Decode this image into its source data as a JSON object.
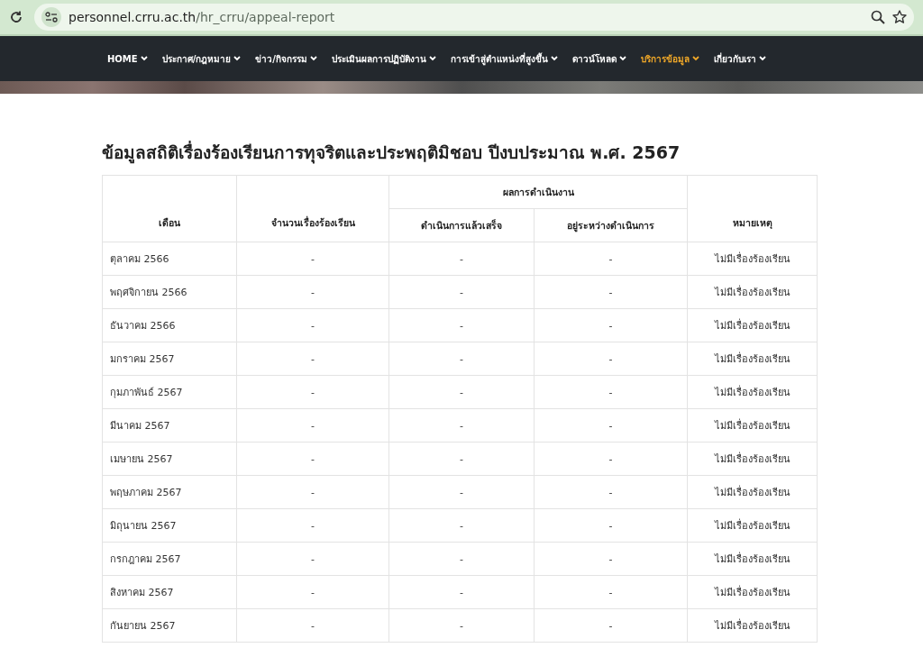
{
  "browser": {
    "url_host": "personnel.crru.ac.th",
    "url_path": "/hr_crru/appeal-report"
  },
  "nav": [
    {
      "label": "HOME",
      "selected": false
    },
    {
      "label": "ประกาศ/กฎหมาย",
      "selected": false
    },
    {
      "label": "ข่าว/กิจกรรม",
      "selected": false
    },
    {
      "label": "ประเมินผลการปฏิบัติงาน",
      "selected": false
    },
    {
      "label": "การเข้าสู่ตำแหน่งที่สูงขึ้น",
      "selected": false
    },
    {
      "label": "ดาวน์โหลด",
      "selected": false
    },
    {
      "label": "บริการข้อมูล",
      "selected": true
    },
    {
      "label": "เกี่ยวกับเรา",
      "selected": false
    }
  ],
  "title": "ข้อมูลสถิติเรื่องร้องเรียนการทุจริตและประพฤติมิชอบ ปีงบประมาณ พ.ศ. 2567",
  "table": {
    "columns": {
      "month": "เดือน",
      "count": "จำนวนเรื่องร้องเรียน",
      "result_group": "ผลการดำเนินงาน",
      "done": "ดำเนินการแล้วเสร็จ",
      "in_progress": "อยู่ระหว่างดำเนินการ",
      "note": "หมายเหตุ"
    },
    "rows": [
      {
        "month": "ตุลาคม 2566",
        "count": "-",
        "done": "-",
        "in_progress": "-",
        "note": "ไม่มีเรื่องร้องเรียน"
      },
      {
        "month": "พฤศจิกายน 2566",
        "count": "-",
        "done": "-",
        "in_progress": "-",
        "note": "ไม่มีเรื่องร้องเรียน"
      },
      {
        "month": "ธันวาคม 2566",
        "count": "-",
        "done": "-",
        "in_progress": "-",
        "note": "ไม่มีเรื่องร้องเรียน"
      },
      {
        "month": "มกราคม 2567",
        "count": "-",
        "done": "-",
        "in_progress": "-",
        "note": "ไม่มีเรื่องร้องเรียน"
      },
      {
        "month": "กุมภาพันธ์ 2567",
        "count": "-",
        "done": "-",
        "in_progress": "-",
        "note": "ไม่มีเรื่องร้องเรียน"
      },
      {
        "month": "มีนาคม 2567",
        "count": "-",
        "done": "-",
        "in_progress": "-",
        "note": "ไม่มีเรื่องร้องเรียน"
      },
      {
        "month": "เมษายน 2567",
        "count": "-",
        "done": "-",
        "in_progress": "-",
        "note": "ไม่มีเรื่องร้องเรียน"
      },
      {
        "month": "พฤษภาคม 2567",
        "count": "-",
        "done": "-",
        "in_progress": "-",
        "note": "ไม่มีเรื่องร้องเรียน"
      },
      {
        "month": "มิถุนายน 2567",
        "count": "-",
        "done": "-",
        "in_progress": "-",
        "note": "ไม่มีเรื่องร้องเรียน"
      },
      {
        "month": "กรกฎาคม 2567",
        "count": "-",
        "done": "-",
        "in_progress": "-",
        "note": "ไม่มีเรื่องร้องเรียน"
      },
      {
        "month": "สิงหาคม 2567",
        "count": "-",
        "done": "-",
        "in_progress": "-",
        "note": "ไม่มีเรื่องร้องเรียน"
      },
      {
        "month": "กันยายน 2567",
        "count": "-",
        "done": "-",
        "in_progress": "-",
        "note": "ไม่มีเรื่องร้องเรียน"
      }
    ]
  }
}
